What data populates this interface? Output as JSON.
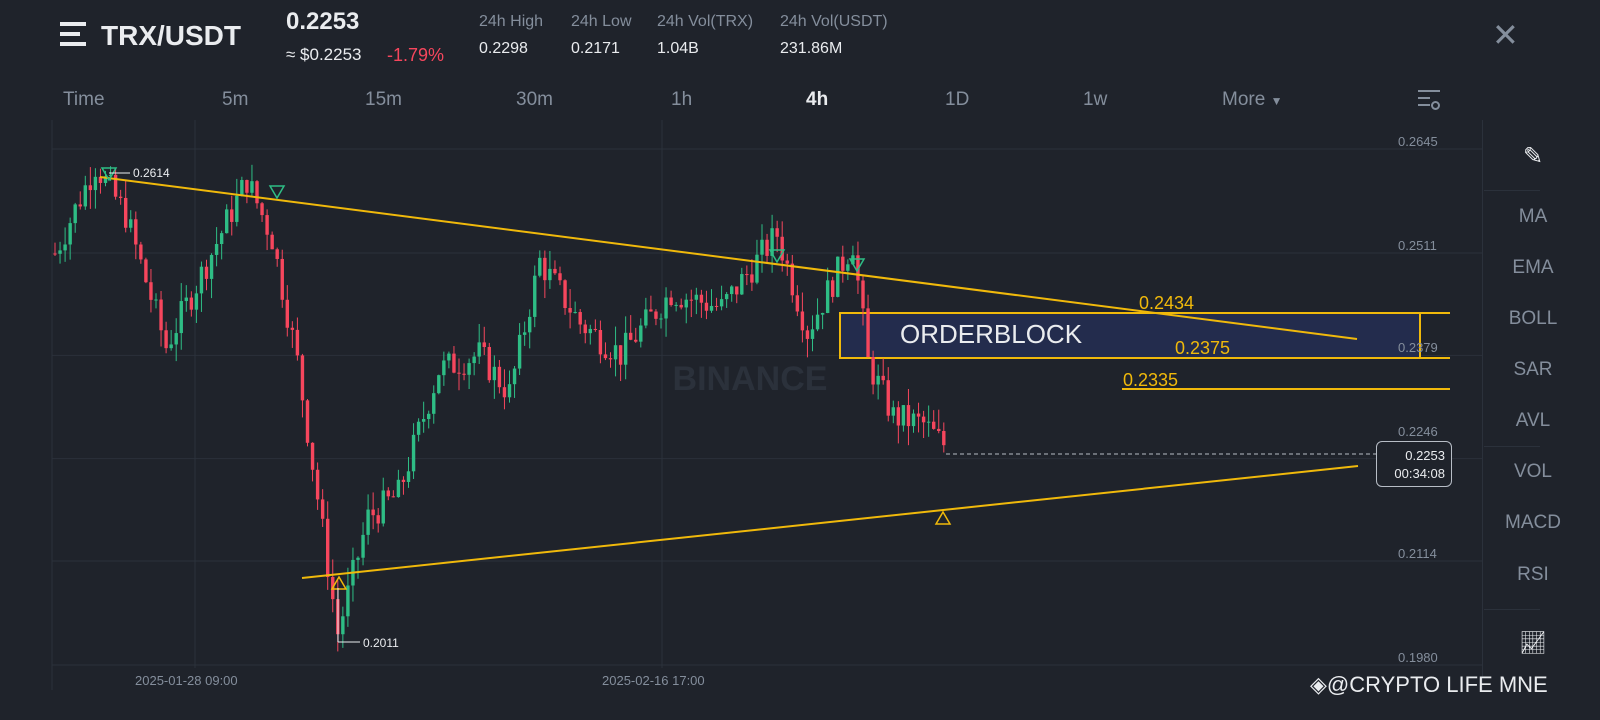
{
  "header": {
    "menu_icon": "menu-icon",
    "pair": "TRX/USDT",
    "last_price": "0.2253",
    "usd_price": "≈ $0.2253",
    "change": "-1.79%",
    "stats": [
      {
        "label": "24h High",
        "value": "0.2298"
      },
      {
        "label": "24h Low",
        "value": "0.2171"
      },
      {
        "label": "24h Vol(TRX)",
        "value": "1.04B"
      },
      {
        "label": "24h Vol(USDT)",
        "value": "231.86M"
      }
    ],
    "close_icon": "close-icon"
  },
  "timeframes": [
    "Time",
    "5m",
    "15m",
    "30m",
    "1h",
    "4h",
    "1D",
    "1w",
    "More"
  ],
  "active_timeframe": "4h",
  "sidebar": {
    "items": [
      "MA",
      "EMA",
      "BOLL",
      "SAR",
      "AVL",
      "VOL",
      "MACD",
      "RSI"
    ]
  },
  "chart": {
    "price_labels": [
      "0.2645",
      "0.2511",
      "0.2379",
      "0.2246",
      "0.2114",
      "0.1980"
    ],
    "time_labels": [
      "2025-01-28 09:00",
      "2025-02-16 17:00"
    ],
    "high_marker": "0.2614",
    "low_marker": "0.2011",
    "current_price": "0.2253",
    "countdown": "00:34:08",
    "annotations": {
      "orderblock": "ORDERBLOCK",
      "level_top": "0.2434",
      "level_mid": "0.2375",
      "level_low": "0.2335"
    },
    "watermark": "BINANCE",
    "credit": "@CRYPTO LIFE MNE",
    "colors": {
      "up": "#2ebd85",
      "down": "#f6465d",
      "annotation": "#f0b90b",
      "orderblock_fill": "#232c4d"
    }
  },
  "chart_data": {
    "type": "candlestick",
    "price_range": [
      0.198,
      0.2645
    ],
    "path": [
      [
        0,
        0.25
      ],
      [
        8,
        0.2614
      ],
      [
        14,
        0.255
      ],
      [
        22,
        0.238
      ],
      [
        28,
        0.246
      ],
      [
        38,
        0.2595
      ],
      [
        43,
        0.252
      ],
      [
        48,
        0.236
      ],
      [
        56,
        0.2011
      ],
      [
        62,
        0.216
      ],
      [
        68,
        0.219
      ],
      [
        76,
        0.235
      ],
      [
        84,
        0.237
      ],
      [
        90,
        0.232
      ],
      [
        96,
        0.249
      ],
      [
        104,
        0.241
      ],
      [
        112,
        0.237
      ],
      [
        122,
        0.245
      ],
      [
        132,
        0.243
      ],
      [
        143,
        0.2525
      ],
      [
        149,
        0.24
      ],
      [
        158,
        0.2514
      ],
      [
        161,
        0.236
      ],
      [
        166,
        0.229
      ],
      [
        172,
        0.228
      ],
      [
        176,
        0.2253
      ]
    ]
  }
}
